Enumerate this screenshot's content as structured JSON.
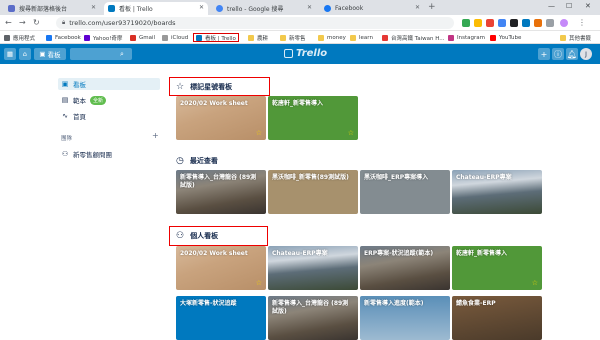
{
  "browser": {
    "tabs": [
      {
        "title": "搜尋新部落格後台",
        "color": "#5b6dc8"
      },
      {
        "title": "看板 | Trello",
        "color": "#0079bf"
      },
      {
        "title": "trello - Google 搜尋",
        "color": "#4285f4"
      },
      {
        "title": "Facebook",
        "color": "#1877f2"
      }
    ],
    "url": "trello.com/user93719020/boards",
    "bookmarks": [
      {
        "label": "應用程式",
        "color": "#5f6368"
      },
      {
        "label": "Facebook",
        "color": "#1877f2"
      },
      {
        "label": "Yahoo!奇摩",
        "color": "#5f01d1"
      },
      {
        "label": "Gmail",
        "color": "#d93025"
      },
      {
        "label": "iCloud",
        "color": "#999999"
      },
      {
        "label": "看板 | Trello",
        "color": "#0079bf"
      },
      {
        "label": "農耕",
        "color": "#f2c94c"
      },
      {
        "label": "新零售",
        "color": "#f2c94c"
      },
      {
        "label": "money",
        "color": "#f2c94c"
      },
      {
        "label": "learn",
        "color": "#f2c94c"
      },
      {
        "label": "台灣高鐵 Taiwan H...",
        "color": "#e53935"
      },
      {
        "label": "Instagram",
        "color": "#c13584"
      },
      {
        "label": "YouTube",
        "color": "#ff0000"
      },
      {
        "label": "其他書籤",
        "color": "#f2c94c"
      }
    ]
  },
  "trello": {
    "boards_button": "看板",
    "logo": "Trello",
    "avatar": "J"
  },
  "sidebar": {
    "items": [
      {
        "label": "看板",
        "icon": "board-icon"
      },
      {
        "label": "範本",
        "icon": "template-icon",
        "badge": "全新"
      },
      {
        "label": "首頁",
        "icon": "home-icon"
      }
    ],
    "teams_heading": "團隊",
    "team": "新零售顧問團"
  },
  "sections": {
    "starred": "標記星號看板",
    "recent": "最近查看",
    "personal": "個人看板"
  },
  "starred_boards": [
    {
      "title": "2020/02 Work sheet",
      "bg": "sand",
      "star": true
    },
    {
      "title": "乾唐軒_新零售導入",
      "bg": "green",
      "star": true
    }
  ],
  "recent_boards": [
    {
      "title": "新零售導入_台灣龍谷 (89測試版)",
      "bg": "cliff"
    },
    {
      "title": "黑沃咖啡_新零售(89測試版)",
      "bg": "tan"
    },
    {
      "title": "黑沃咖啡_ERP專案導入",
      "bg": "gray"
    },
    {
      "title": "Chateau-ERP專案",
      "bg": "mtn"
    }
  ],
  "personal_boards": [
    {
      "title": "2020/02 Work sheet",
      "bg": "sand",
      "star": true
    },
    {
      "title": "Chateau-ERP專案",
      "bg": "mtn"
    },
    {
      "title": "ERP專案-狀況追蹤(範本)",
      "bg": "cliff"
    },
    {
      "title": "乾唐軒_新零售導入",
      "bg": "green",
      "star": true
    }
  ],
  "personal_boards_row2": [
    {
      "title": "大塚新零售-狀況追蹤",
      "bg": "blue"
    },
    {
      "title": "新零售導入_台灣龍谷 (89測試版)",
      "bg": "cliff"
    },
    {
      "title": "新零售導入進度(範本)",
      "bg": "sky"
    },
    {
      "title": "鯖魚食業-ERP",
      "bg": "brown"
    }
  ]
}
